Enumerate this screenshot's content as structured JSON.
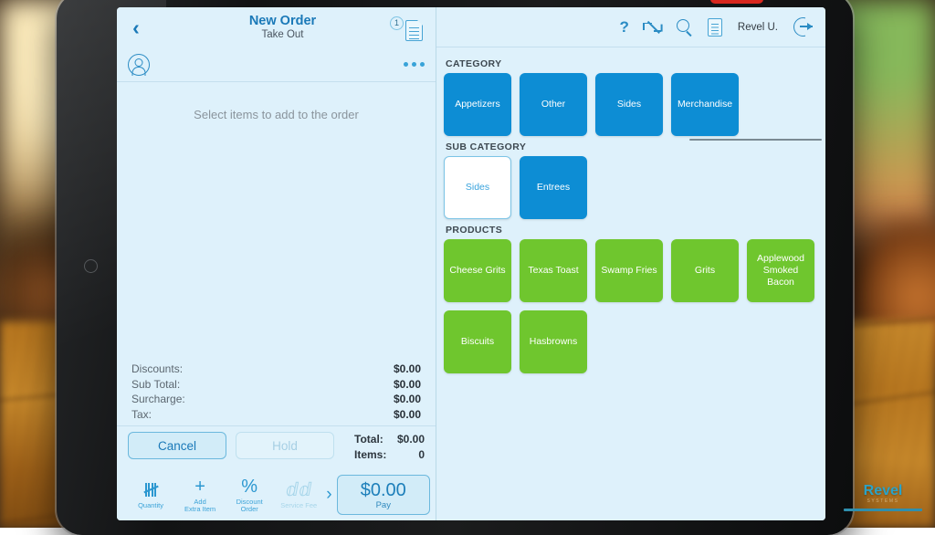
{
  "order": {
    "back_label": "‹",
    "title": "New Order",
    "subtitle": "Take Out",
    "doc_badge_count": "1",
    "empty_message": "Select items to add to the order",
    "summary": [
      {
        "label": "Discounts:",
        "value": "$0.00"
      },
      {
        "label": "Sub Total:",
        "value": "$0.00"
      },
      {
        "label": "Surcharge:",
        "value": "$0.00"
      },
      {
        "label": "Tax:",
        "value": "$0.00"
      }
    ],
    "grand": [
      {
        "label": "Total:",
        "value": "$0.00"
      },
      {
        "label": "Items:",
        "value": "0"
      }
    ],
    "cancel_label": "Cancel",
    "hold_label": "Hold"
  },
  "toolbar": {
    "tools": [
      {
        "icon": "tally-marks-icon",
        "line1": "Quantity",
        "line2": "",
        "disabled": false
      },
      {
        "icon": "plus-icon",
        "line1": "Add",
        "line2": "Extra Item",
        "disabled": false
      },
      {
        "icon": "percent-icon",
        "line1": "Discount",
        "line2": "Order",
        "disabled": false
      },
      {
        "icon": "service-fee-icon",
        "line1": "Service Fee",
        "line2": "",
        "disabled": true
      }
    ],
    "next_arrow": "›",
    "pay_amount": "$0.00",
    "pay_label": "Pay"
  },
  "header": {
    "help_icon": "question-mark-icon",
    "expand_icon": "expand-diagonal-icon",
    "search_icon": "search-icon",
    "document_icon": "document-icon",
    "user_name": "Revel U.",
    "logout_icon": "logout-icon"
  },
  "menu": {
    "category_label": "CATEGORY",
    "categories": [
      {
        "name": "Appetizers",
        "selected": false
      },
      {
        "name": "Other",
        "selected": false
      },
      {
        "name": "Sides",
        "selected": false
      },
      {
        "name": "Merchandise",
        "selected": false
      }
    ],
    "subcategory_label": "SUB CATEGORY",
    "subcategories": [
      {
        "name": "Sides",
        "selected": true
      },
      {
        "name": "Entrees",
        "selected": false
      }
    ],
    "products_label": "PRODUCTS",
    "products": [
      {
        "name": "Cheese Grits"
      },
      {
        "name": "Texas Toast"
      },
      {
        "name": "Swamp Fries"
      },
      {
        "name": "Grits"
      },
      {
        "name": "Applewood Smoked Bacon"
      },
      {
        "name": "Biscuits"
      },
      {
        "name": "Hasbrowns"
      }
    ]
  },
  "watermark": {
    "brand": "Revel",
    "tagline": "SYSTEMS"
  },
  "colors": {
    "accent_blue": "#0d8dd4",
    "product_green": "#6fc62e",
    "panel_bg": "#def1fb",
    "link_blue": "#1a79b8",
    "notch_red": "#d9281f"
  }
}
